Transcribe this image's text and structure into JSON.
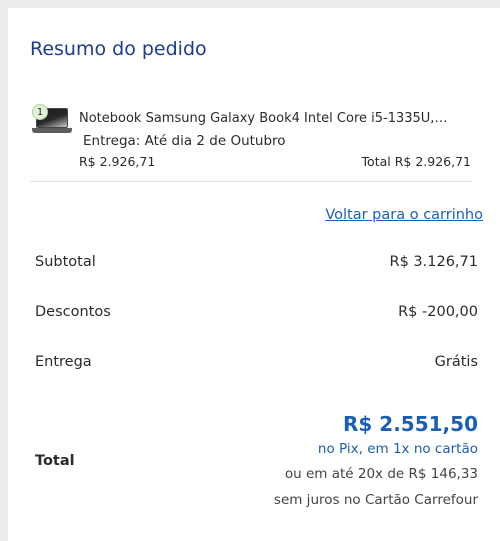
{
  "summary": {
    "title": "Resumo do pedido"
  },
  "product": {
    "quantity": "1",
    "name": "Notebook Samsung Galaxy Book4 Intel Core i5-1335U,…",
    "delivery": "Entrega: Até dia 2 de Outubro",
    "unit_price": "R$ 2.926,71",
    "total": "Total  R$ 2.926,71",
    "image_icon": "laptop-icon"
  },
  "actions": {
    "back_to_cart": "Voltar para o carrinho"
  },
  "rows": {
    "subtotal_label": "Subtotal",
    "subtotal_value": "R$ 3.126,71",
    "discount_label": "Descontos",
    "discount_value": "R$ -200,00",
    "delivery_label": "Entrega",
    "delivery_value": "Grátis"
  },
  "total": {
    "label": "Total",
    "amount": "R$ 2.551,50",
    "pix_note": "no Pix, em 1x no cartão",
    "installments_line1": "ou em até 20x de R$ 146,33",
    "installments_line2": "sem juros no Cartão Carrefour"
  },
  "colors": {
    "accent": "#1a5fb4",
    "title": "#1a3d8f",
    "background": "#ececec",
    "card": "#ffffff"
  }
}
